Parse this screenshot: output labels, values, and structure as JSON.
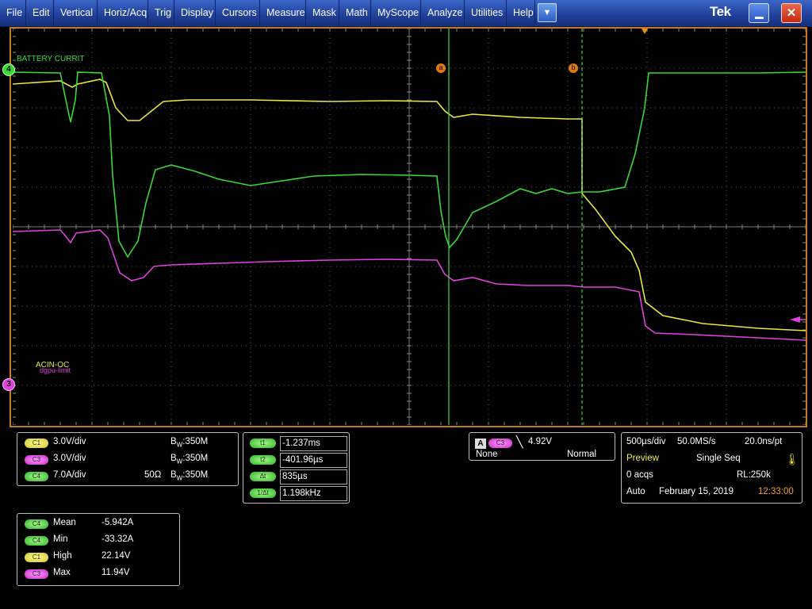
{
  "menu": {
    "items": [
      "File",
      "Edit",
      "Vertical",
      "Horiz/Acq",
      "Trig",
      "Display",
      "Cursors",
      "Measure",
      "Mask",
      "Math",
      "MyScope",
      "Analyze",
      "Utilities",
      "Help"
    ],
    "dropdown_icon": "chevron-down-icon",
    "brand": "Tek",
    "close_glyph": "✕"
  },
  "waveform": {
    "label_battery": "BATTERY CURRIT",
    "label_acin": "ACIN-OC",
    "label_gpu": "dgpu-limit",
    "ch4_marker": "4",
    "ch3_marker": "3",
    "cursor_a": "a",
    "cursor_b": "b",
    "colors": {
      "c1": "#e8e838",
      "c3": "#e040e0",
      "c4": "#38d838",
      "cursor": "#38e038",
      "frame": "#c47a22"
    }
  },
  "channels": [
    {
      "tag": "C1",
      "scale": "3.0V/div",
      "term": "",
      "bw": "350M"
    },
    {
      "tag": "C3",
      "scale": "3.0V/div",
      "term": "",
      "bw": "350M"
    },
    {
      "tag": "C4",
      "scale": "7.0A/div",
      "term": "50Ω",
      "bw": "350M"
    }
  ],
  "bw_prefix": "B",
  "bw_sub": "W",
  "cursors": [
    {
      "tag": "t1",
      "value": "-1.237ms"
    },
    {
      "tag": "t2",
      "value": "-401.96µs"
    },
    {
      "tag": "Δt",
      "value": "835µs"
    },
    {
      "tag": "1/Δt",
      "value": "1.198kHz"
    }
  ],
  "trigger": {
    "mode_box": "A",
    "source": "C3",
    "slope_glyph": "⌐",
    "level": "4.92V",
    "coupling": "None",
    "type": "Normal"
  },
  "acquisition": {
    "timebase": "500µs/div",
    "sample_rate": "50.0MS/s",
    "resolution": "20.0ns/pt",
    "status": "Preview",
    "mode": "Single Seq",
    "acqs": "0 acqs",
    "record_length": "RL:250k",
    "run_mode": "Auto",
    "date": "February 15, 2019",
    "time": "12:33:00"
  },
  "measurements": [
    {
      "tag": "C4",
      "name": "Mean",
      "value": "-5.942A"
    },
    {
      "tag": "C4",
      "name": "Min",
      "value": "-33.32A"
    },
    {
      "tag": "C1",
      "name": "High",
      "value": "22.14V"
    },
    {
      "tag": "C3",
      "name": "Max",
      "value": "11.94V"
    }
  ]
}
